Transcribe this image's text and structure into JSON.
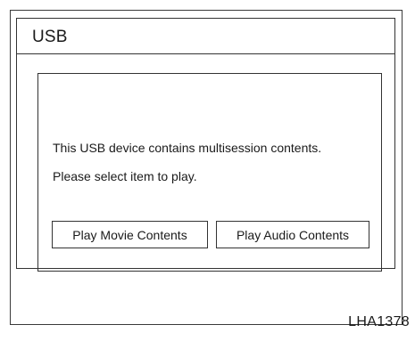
{
  "screen": {
    "title": "USB"
  },
  "dialog": {
    "message_line1": "This USB device contains multisession contents.",
    "message_line2": "Please select item to play.",
    "buttons": {
      "movie_label": "Play Movie Contents",
      "audio_label": "Play Audio Contents"
    }
  },
  "figure": {
    "code": "LHA1378"
  }
}
